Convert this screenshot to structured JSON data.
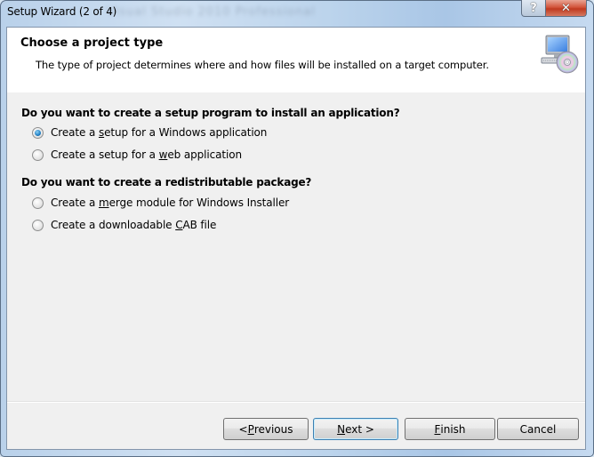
{
  "window": {
    "title": "Setup Wizard (2 of 4)",
    "background_ghost_title": "Visual Studio 2010 Professional",
    "help_button_glyph": "?",
    "close_button_glyph": "✕"
  },
  "header": {
    "title": "Choose a project type",
    "description": "The type of project determines where and how files will be installed on a target computer.",
    "icon": "computer-with-disc-icon"
  },
  "sections": [
    {
      "heading": "Do you want to create a setup program to install an application?",
      "options": [
        {
          "pre": "Create a ",
          "accel": "s",
          "post": "etup for a Windows application",
          "checked": true
        },
        {
          "pre": "Create a setup for a ",
          "accel": "w",
          "post": "eb application",
          "checked": false
        }
      ]
    },
    {
      "heading": "Do you want to create a redistributable package?",
      "options": [
        {
          "pre": "Create a ",
          "accel": "m",
          "post": "erge module for Windows Installer",
          "checked": false
        },
        {
          "pre": "Create a downloadable ",
          "accel": "C",
          "post": "AB file",
          "checked": false
        }
      ]
    }
  ],
  "buttons": {
    "previous": {
      "pre": "< ",
      "accel": "P",
      "post": "revious"
    },
    "next": {
      "pre": "",
      "accel": "N",
      "post": "ext >"
    },
    "finish": {
      "pre": "",
      "accel": "F",
      "post": "inish"
    },
    "cancel": {
      "pre": "Cancel",
      "accel": "",
      "post": ""
    }
  },
  "colors": {
    "radio_selected": "#1f7fc4",
    "close_button": "#c03a20",
    "default_button_border": "#3c7fb1"
  }
}
